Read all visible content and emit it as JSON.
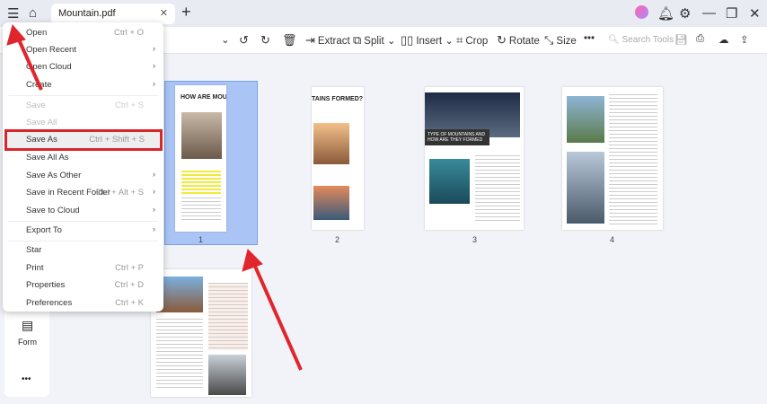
{
  "tab": {
    "title": "Mountain.pdf"
  },
  "toolbar": {
    "extract": "Extract",
    "split": "Split",
    "insert": "Insert",
    "crop": "Crop",
    "rotate": "Rotate",
    "size": "Size",
    "search_placeholder": "Search Tools"
  },
  "menu": {
    "items": [
      {
        "label": "Open",
        "shortcut": "Ctrl + O"
      },
      {
        "label": "Open Recent"
      },
      {
        "label": "Open Cloud"
      },
      {
        "label": "Create"
      },
      {
        "label": "Save",
        "shortcut": "Ctrl + S"
      },
      {
        "label": "Save All"
      },
      {
        "label": "Save As",
        "shortcut": "Ctrl + Shift + S"
      },
      {
        "label": "Save All As"
      },
      {
        "label": "Save As Other"
      },
      {
        "label": "Save in Recent Folder",
        "shortcut": "Ctrl + Alt + S"
      },
      {
        "label": "Save to Cloud"
      },
      {
        "label": "Export To"
      },
      {
        "label": "Star"
      },
      {
        "label": "Print",
        "shortcut": "Ctrl + P"
      },
      {
        "label": "Properties",
        "shortcut": "Ctrl + D"
      },
      {
        "label": "Preferences",
        "shortcut": "Ctrl + K"
      }
    ]
  },
  "sidebar": {
    "form": "Form"
  },
  "pages": {
    "p1": "1",
    "p2": "2",
    "p3": "3",
    "p4": "4",
    "p1_title": "HOW ARE MOUNT",
    "p2_title": "TAINS FORMED?",
    "p3_banner": "TYPE OF MOUNTAINS AND HOW ARE THEY FORMED"
  },
  "colors": {
    "accent": "#d7262c",
    "selection": "#a9c4f5"
  }
}
